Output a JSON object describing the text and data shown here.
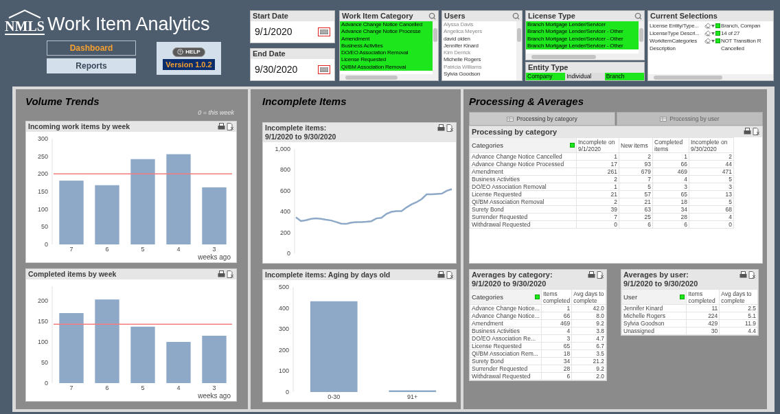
{
  "header": {
    "logo_text": "NMLS",
    "title": "Work Item Analytics",
    "nav": [
      {
        "label": "Dashboard",
        "selected": true
      },
      {
        "label": "Reports",
        "selected": false
      }
    ],
    "help_label": "HELP",
    "version": "Version 1.0.2"
  },
  "start_date": {
    "label": "Start Date",
    "value": "9/1/2020"
  },
  "end_date": {
    "label": "End Date",
    "value": "9/30/2020"
  },
  "work_item_category": {
    "title": "Work Item Category",
    "items": [
      {
        "label": "Advance Change Notice Cancelled",
        "selected": true
      },
      {
        "label": "Advance Change Notice Processe",
        "selected": true
      },
      {
        "label": "Amendment",
        "selected": true
      },
      {
        "label": "Business Activties",
        "selected": true
      },
      {
        "label": "DO/EO Association Removal",
        "selected": true
      },
      {
        "label": "License Requested",
        "selected": true
      },
      {
        "label": "QI/BM Association Removal",
        "selected": true
      }
    ]
  },
  "users": {
    "title": "Users",
    "items": [
      {
        "label": "Alyssa Davis",
        "selected": false,
        "excluded": true
      },
      {
        "label": "Angelica Meyers",
        "selected": false,
        "excluded": true
      },
      {
        "label": "david olden",
        "selected": false,
        "excluded": false
      },
      {
        "label": "Jennifer Kinard",
        "selected": false,
        "excluded": false
      },
      {
        "label": "Kim Derrick",
        "selected": false,
        "excluded": true
      },
      {
        "label": "Michelle Rogers",
        "selected": false,
        "excluded": false
      },
      {
        "label": "Patricia Williams",
        "selected": false,
        "excluded": true
      },
      {
        "label": "Sylvia Goodson",
        "selected": false,
        "excluded": false
      }
    ]
  },
  "license_type": {
    "title": "License Type",
    "items": [
      {
        "label": "Branch Mortgage Lender/Servicer",
        "selected": true
      },
      {
        "label": "Branch Mortgage Lender/Servicer - Other",
        "selected": true
      },
      {
        "label": "Branch Mortgage Lender/Servicer - Other",
        "selected": true
      },
      {
        "label": "Branch Mortgage Lender/Servicer - Other",
        "selected": true
      }
    ]
  },
  "entity_type": {
    "title": "Entity Type",
    "items": [
      {
        "label": "Company",
        "selected": true
      },
      {
        "label": "Individual",
        "selected": false
      },
      {
        "label": "Branch",
        "selected": true
      }
    ]
  },
  "current_selections": {
    "title": "Current Selections",
    "rows": [
      {
        "kind": "selection",
        "field": "License Entity/Type...",
        "value": "Branch, Compan"
      },
      {
        "kind": "selection",
        "field": "LicenseType Descri...",
        "value": "14 of 27"
      },
      {
        "kind": "selection",
        "field": "WorkItemCategories",
        "value": "NOT Transition R"
      },
      {
        "kind": "continuation",
        "field": "Description",
        "value": "Cancelled"
      }
    ]
  },
  "volume_trends": {
    "title": "Volume Trends",
    "note": "0 = this week",
    "charts": [
      {
        "title": "Incoming work items by week",
        "chart_data": {
          "type": "bar",
          "categories": [
            "7",
            "6",
            "5",
            "4",
            "3"
          ],
          "xlabel": "weeks ago",
          "ylim": [
            0,
            300
          ],
          "yticks": [
            0,
            50,
            100,
            150,
            200,
            250,
            300
          ],
          "series": [
            {
              "color": "#8ea9c8",
              "values": [
                181,
                168,
                242,
                256,
                162
              ]
            }
          ],
          "ref_lines": [
            {
              "axis": "y",
              "value": 200,
              "color": "#f47c7c"
            }
          ]
        }
      },
      {
        "title": "Completed items by week",
        "chart_data": {
          "type": "bar",
          "categories": [
            "7",
            "6",
            "5",
            "4",
            "3"
          ],
          "xlabel": "weeks ago",
          "ylim": [
            0,
            235
          ],
          "yticks": [
            0,
            50,
            100,
            150,
            200
          ],
          "series": [
            {
              "color": "#8ea9c8",
              "values": [
                170,
                203,
                137,
                100,
                115
              ]
            }
          ],
          "ref_lines": [
            {
              "axis": "y",
              "value": 143,
              "color": "#f47c7c"
            }
          ]
        }
      }
    ]
  },
  "incomplete_items": {
    "title": "Incomplete Items",
    "charts": [
      {
        "title": "Incomplete items:\n9/1/2020 to 9/30/2020",
        "chart_data": {
          "type": "line",
          "ylim": [
            0,
            1000
          ],
          "yticks": [
            0,
            200,
            400,
            600,
            800,
            {
              "value": 1000,
              "label": "1,000"
            }
          ],
          "series": [
            {
              "color": "#8ea9c8",
              "values": [
                345,
                310,
                318,
                330,
                335,
                330,
                322,
                315,
                300,
                285,
                282,
                295,
                300,
                300,
                303,
                308,
                335,
                340,
                378,
                398,
                405,
                405,
                440,
                470,
                490,
                520,
                565,
                565,
                570,
                572,
                600,
                615
              ]
            }
          ]
        }
      },
      {
        "title": "Incomplete items: Aging by days old",
        "chart_data": {
          "type": "bar",
          "categories": [
            "0-30",
            "91+"
          ],
          "ylim": [
            0,
            500
          ],
          "yticks": [
            0,
            100,
            200,
            300,
            400,
            500
          ],
          "series": [
            {
              "color": "#8ea9c8",
              "values": [
                432,
                8
              ]
            }
          ]
        }
      }
    ]
  },
  "processing": {
    "title": "Processing & Averages",
    "tabs": [
      {
        "label": "Processing by category",
        "selected": true
      },
      {
        "label": "Processing by user",
        "selected": false
      }
    ],
    "category_table": {
      "title": "Processing by category",
      "columns": [
        "Categories",
        "Incomplete on 9/1/2020",
        "New items",
        "Completed items",
        "Incomplete on 9/30/2020"
      ],
      "rows": [
        [
          "Advance Change Notice Cancelled",
          "1",
          "2",
          "1",
          "2"
        ],
        [
          "Advance Change Notice Processed",
          "17",
          "93",
          "66",
          "44"
        ],
        [
          "Amendment",
          "261",
          "679",
          "469",
          "471"
        ],
        [
          "Business Activities",
          "2",
          "7",
          "4",
          "5"
        ],
        [
          "DO/EO Association Removal",
          "1",
          "5",
          "3",
          "3"
        ],
        [
          "License Requested",
          "21",
          "57",
          "65",
          "13"
        ],
        [
          "QI/BM Association Removal",
          "2",
          "21",
          "18",
          "5"
        ],
        [
          "Surety Bond",
          "39",
          "63",
          "34",
          "68"
        ],
        [
          "Surrender Requested",
          "7",
          "25",
          "28",
          "4"
        ],
        [
          "Withdrawal Requested",
          "0",
          "6",
          "6",
          "0"
        ]
      ]
    },
    "averages_by_category": {
      "title": "Averages by category:\n9/1/2020 to 9/30/2020",
      "columns": [
        "Categories",
        "Items completed",
        "Avg days to complete"
      ],
      "rows": [
        [
          "Advance Change Notice...",
          "1",
          "42.0"
        ],
        [
          "Advance Change Notice...",
          "66",
          "8.0"
        ],
        [
          "Amendment",
          "469",
          "9.2"
        ],
        [
          "Business Activities",
          "4",
          "3.8"
        ],
        [
          "DO/EO Association Re...",
          "3",
          "4.7"
        ],
        [
          "License Requested",
          "65",
          "6.7"
        ],
        [
          "QI/BM Association Rem...",
          "18",
          "3.5"
        ],
        [
          "Surety Bond",
          "34",
          "21.2"
        ],
        [
          "Surrender Requested",
          "28",
          "9.2"
        ],
        [
          "Withdrawal Requested",
          "6",
          "2.0"
        ]
      ]
    },
    "averages_by_user": {
      "title": "Averages by user:\n9/1/2020 to 9/30/2020",
      "columns": [
        "User",
        "Items completed",
        "Avg days to complete"
      ],
      "rows": [
        [
          "Jennifer Kinard",
          "11",
          "2.5"
        ],
        [
          "Michelle Rogers",
          "224",
          "5.1"
        ],
        [
          "Sylvia Goodson",
          "429",
          "11.9"
        ],
        [
          "Unassigned",
          "30",
          "4.4"
        ]
      ]
    }
  }
}
